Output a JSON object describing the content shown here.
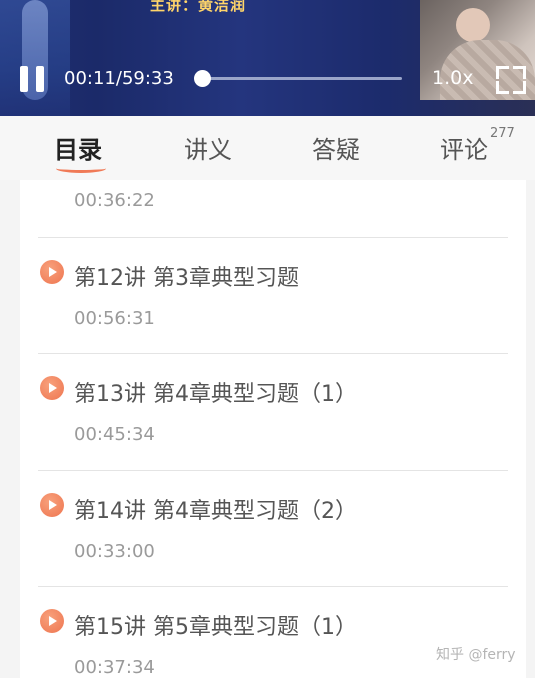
{
  "player": {
    "lecturer": "主讲：黄洁润",
    "current_time": "00:11/59:33",
    "progress": 0.0,
    "speed": "1.0x"
  },
  "tabs": [
    {
      "label": "目录",
      "active": true
    },
    {
      "label": "讲义"
    },
    {
      "label": "答疑"
    },
    {
      "label": "评论",
      "count": "277"
    }
  ],
  "lessons": [
    {
      "duration": "00:36:22"
    },
    {
      "title": "第12讲 第3章典型习题",
      "duration": "00:56:31"
    },
    {
      "title": "第13讲 第4章典型习题（1）",
      "duration": "00:45:34"
    },
    {
      "title": "第14讲 第4章典型习题（2）",
      "duration": "00:33:00"
    },
    {
      "title": "第15讲 第5章典型习题（1）",
      "duration": "00:37:34"
    }
  ],
  "watermark": "知乎 @ferry",
  "colors": {
    "accent": "#f07a57",
    "player_bg": "#1f2f72"
  }
}
